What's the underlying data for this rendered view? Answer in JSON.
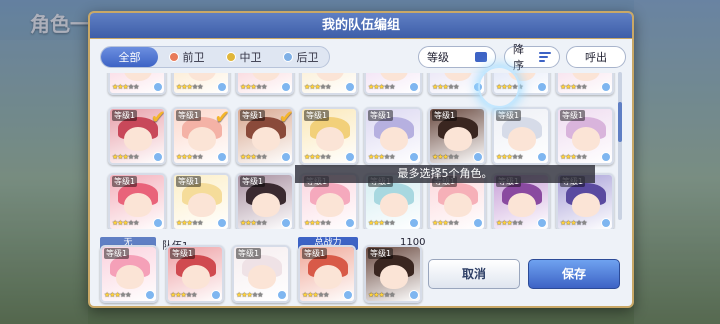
{
  "background": {
    "title": "角色一览"
  },
  "dialog": {
    "title": "我的队伍编组",
    "filters": [
      {
        "label": "全部",
        "active": true,
        "color": ""
      },
      {
        "label": "前卫",
        "active": false,
        "color": "#e87b5a"
      },
      {
        "label": "中卫",
        "active": false,
        "color": "#e0b63a"
      },
      {
        "label": "后卫",
        "active": false,
        "color": "#7fb0e6"
      }
    ],
    "level_label": "等级",
    "sort_label": "降序",
    "hide_label": "呼出",
    "toast": "最多选择5个角色。",
    "team_tag": "无",
    "team_name": "队伍1",
    "power_label": "总战力",
    "power_value": "1100",
    "cancel_label": "取消",
    "save_label": "保存",
    "level_text": "等级1"
  },
  "colors": {
    "header": "#3e5ea8",
    "accent": "#3d63c5",
    "gold": "#c9a867"
  },
  "grid": {
    "rows": [
      [
        {
          "hair": "#f29aa8",
          "bg": "#f7c6d6",
          "stars": 3,
          "selected": false
        },
        {
          "hair": "#f3c88a",
          "bg": "#fbe0b8",
          "stars": 3,
          "selected": false
        },
        {
          "hair": "#e58a9a",
          "bg": "#f6c0c8",
          "stars": 3,
          "selected": false
        },
        {
          "hair": "#f0d28f",
          "bg": "#f8e6bf",
          "stars": 3,
          "selected": false
        },
        {
          "hair": "#d6a0d8",
          "bg": "#ead1ef",
          "stars": 3,
          "selected": false
        },
        {
          "hair": "#b7b0d9",
          "bg": "#ddd6f0",
          "stars": 3,
          "selected": false
        },
        {
          "hair": "#9ab0e2",
          "bg": "#cfd9f3",
          "stars": 3,
          "selected": false
        },
        {
          "hair": "#e0a0c8",
          "bg": "#f2cfe2",
          "stars": 3,
          "selected": false
        }
      ],
      [
        {
          "hair": "#c8485a",
          "bg": "#e8a0aa",
          "stars": 3,
          "selected": true
        },
        {
          "hair": "#f4b2a6",
          "bg": "#fcd8cc",
          "stars": 3,
          "selected": true
        },
        {
          "hair": "#8a4a3a",
          "bg": "#d8a890",
          "stars": 3,
          "selected": true
        },
        {
          "hair": "#f2d07a",
          "bg": "#fbe8b8",
          "stars": 3,
          "selected": false
        },
        {
          "hair": "#b6b0e0",
          "bg": "#dcd8f2",
          "stars": 3,
          "selected": false
        },
        {
          "hair": "#3a2620",
          "bg": "#6a4a40",
          "stars": 3,
          "selected": false
        },
        {
          "hair": "#d6dbe8",
          "bg": "#eef0f6",
          "stars": 3,
          "selected": false
        },
        {
          "hair": "#d9b4dc",
          "bg": "#efdcf0",
          "stars": 3,
          "selected": false
        }
      ],
      [
        {
          "hair": "#e9637a",
          "bg": "#f4b0bc",
          "stars": 3,
          "selected": false
        },
        {
          "hair": "#f5dc9a",
          "bg": "#fcefc8",
          "stars": 3,
          "selected": false
        },
        {
          "hair": "#3a2a30",
          "bg": "#a890a0",
          "stars": 3,
          "selected": false
        },
        {
          "hair": "#f5a9bd",
          "bg": "#fbd6e0",
          "stars": 3,
          "selected": false
        },
        {
          "hair": "#a8d8e0",
          "bg": "#d4eef2",
          "stars": 3,
          "selected": false
        },
        {
          "hair": "#f6b0b8",
          "bg": "#fcd8dc",
          "stars": 3,
          "selected": false
        },
        {
          "hair": "#8a4aa0",
          "bg": "#c8a0d8",
          "stars": 3,
          "selected": false
        },
        {
          "hair": "#5a4aa0",
          "bg": "#a8a0d8",
          "stars": 3,
          "selected": false
        }
      ]
    ]
  },
  "team": [
    {
      "hair": "#f5a0b8",
      "bg": "#fbd2de",
      "stars": 3
    },
    {
      "hair": "#d04a50",
      "bg": "#eea0a4",
      "stars": 3
    },
    {
      "hair": "#efe2e6",
      "bg": "#f6eef0",
      "stars": 3
    },
    {
      "hair": "#d85a48",
      "bg": "#f0a898",
      "stars": 3
    },
    {
      "hair": "#3a2620",
      "bg": "#6a4a40",
      "stars": 3
    }
  ]
}
